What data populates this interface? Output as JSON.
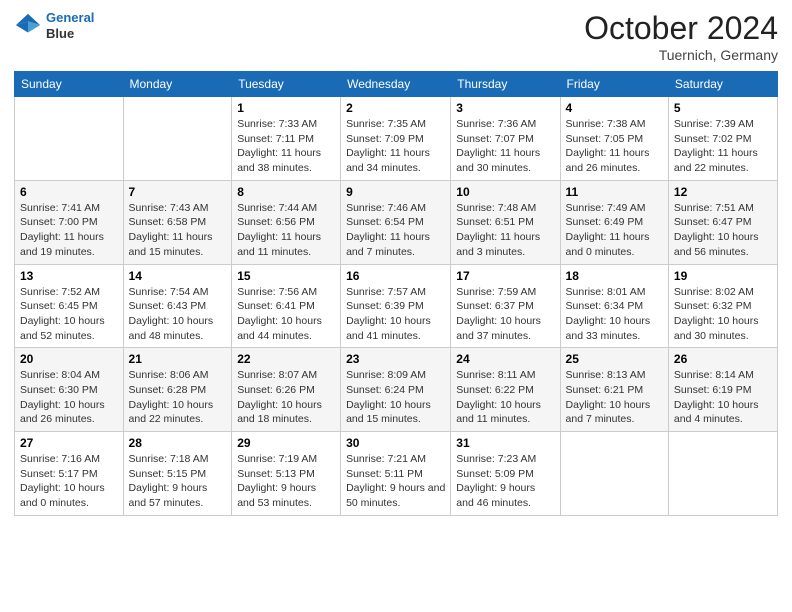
{
  "header": {
    "logo_line1": "General",
    "logo_line2": "Blue",
    "month": "October 2024",
    "location": "Tuernich, Germany"
  },
  "days_of_week": [
    "Sunday",
    "Monday",
    "Tuesday",
    "Wednesday",
    "Thursday",
    "Friday",
    "Saturday"
  ],
  "weeks": [
    [
      {
        "day": "",
        "info": ""
      },
      {
        "day": "",
        "info": ""
      },
      {
        "day": "1",
        "info": "Sunrise: 7:33 AM\nSunset: 7:11 PM\nDaylight: 11 hours and 38 minutes."
      },
      {
        "day": "2",
        "info": "Sunrise: 7:35 AM\nSunset: 7:09 PM\nDaylight: 11 hours and 34 minutes."
      },
      {
        "day": "3",
        "info": "Sunrise: 7:36 AM\nSunset: 7:07 PM\nDaylight: 11 hours and 30 minutes."
      },
      {
        "day": "4",
        "info": "Sunrise: 7:38 AM\nSunset: 7:05 PM\nDaylight: 11 hours and 26 minutes."
      },
      {
        "day": "5",
        "info": "Sunrise: 7:39 AM\nSunset: 7:02 PM\nDaylight: 11 hours and 22 minutes."
      }
    ],
    [
      {
        "day": "6",
        "info": "Sunrise: 7:41 AM\nSunset: 7:00 PM\nDaylight: 11 hours and 19 minutes."
      },
      {
        "day": "7",
        "info": "Sunrise: 7:43 AM\nSunset: 6:58 PM\nDaylight: 11 hours and 15 minutes."
      },
      {
        "day": "8",
        "info": "Sunrise: 7:44 AM\nSunset: 6:56 PM\nDaylight: 11 hours and 11 minutes."
      },
      {
        "day": "9",
        "info": "Sunrise: 7:46 AM\nSunset: 6:54 PM\nDaylight: 11 hours and 7 minutes."
      },
      {
        "day": "10",
        "info": "Sunrise: 7:48 AM\nSunset: 6:51 PM\nDaylight: 11 hours and 3 minutes."
      },
      {
        "day": "11",
        "info": "Sunrise: 7:49 AM\nSunset: 6:49 PM\nDaylight: 11 hours and 0 minutes."
      },
      {
        "day": "12",
        "info": "Sunrise: 7:51 AM\nSunset: 6:47 PM\nDaylight: 10 hours and 56 minutes."
      }
    ],
    [
      {
        "day": "13",
        "info": "Sunrise: 7:52 AM\nSunset: 6:45 PM\nDaylight: 10 hours and 52 minutes."
      },
      {
        "day": "14",
        "info": "Sunrise: 7:54 AM\nSunset: 6:43 PM\nDaylight: 10 hours and 48 minutes."
      },
      {
        "day": "15",
        "info": "Sunrise: 7:56 AM\nSunset: 6:41 PM\nDaylight: 10 hours and 44 minutes."
      },
      {
        "day": "16",
        "info": "Sunrise: 7:57 AM\nSunset: 6:39 PM\nDaylight: 10 hours and 41 minutes."
      },
      {
        "day": "17",
        "info": "Sunrise: 7:59 AM\nSunset: 6:37 PM\nDaylight: 10 hours and 37 minutes."
      },
      {
        "day": "18",
        "info": "Sunrise: 8:01 AM\nSunset: 6:34 PM\nDaylight: 10 hours and 33 minutes."
      },
      {
        "day": "19",
        "info": "Sunrise: 8:02 AM\nSunset: 6:32 PM\nDaylight: 10 hours and 30 minutes."
      }
    ],
    [
      {
        "day": "20",
        "info": "Sunrise: 8:04 AM\nSunset: 6:30 PM\nDaylight: 10 hours and 26 minutes."
      },
      {
        "day": "21",
        "info": "Sunrise: 8:06 AM\nSunset: 6:28 PM\nDaylight: 10 hours and 22 minutes."
      },
      {
        "day": "22",
        "info": "Sunrise: 8:07 AM\nSunset: 6:26 PM\nDaylight: 10 hours and 18 minutes."
      },
      {
        "day": "23",
        "info": "Sunrise: 8:09 AM\nSunset: 6:24 PM\nDaylight: 10 hours and 15 minutes."
      },
      {
        "day": "24",
        "info": "Sunrise: 8:11 AM\nSunset: 6:22 PM\nDaylight: 10 hours and 11 minutes."
      },
      {
        "day": "25",
        "info": "Sunrise: 8:13 AM\nSunset: 6:21 PM\nDaylight: 10 hours and 7 minutes."
      },
      {
        "day": "26",
        "info": "Sunrise: 8:14 AM\nSunset: 6:19 PM\nDaylight: 10 hours and 4 minutes."
      }
    ],
    [
      {
        "day": "27",
        "info": "Sunrise: 7:16 AM\nSunset: 5:17 PM\nDaylight: 10 hours and 0 minutes."
      },
      {
        "day": "28",
        "info": "Sunrise: 7:18 AM\nSunset: 5:15 PM\nDaylight: 9 hours and 57 minutes."
      },
      {
        "day": "29",
        "info": "Sunrise: 7:19 AM\nSunset: 5:13 PM\nDaylight: 9 hours and 53 minutes."
      },
      {
        "day": "30",
        "info": "Sunrise: 7:21 AM\nSunset: 5:11 PM\nDaylight: 9 hours and 50 minutes."
      },
      {
        "day": "31",
        "info": "Sunrise: 7:23 AM\nSunset: 5:09 PM\nDaylight: 9 hours and 46 minutes."
      },
      {
        "day": "",
        "info": ""
      },
      {
        "day": "",
        "info": ""
      }
    ]
  ]
}
